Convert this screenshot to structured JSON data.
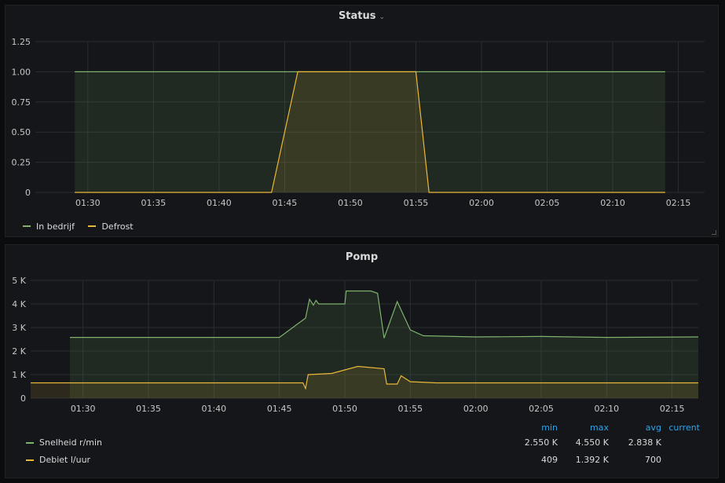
{
  "panels": [
    {
      "title": "Status",
      "chart_data": {
        "type": "area",
        "x_ticks": [
          "01:30",
          "01:35",
          "01:40",
          "01:45",
          "01:50",
          "01:55",
          "02:00",
          "02:05",
          "02:10",
          "02:15"
        ],
        "y_ticks": [
          "1.25",
          "1.00",
          "0.75",
          "0.50",
          "0.25",
          "0"
        ],
        "ylim": [
          0,
          1.25
        ],
        "xlim_minutes": [
          "01:26",
          "02:17"
        ],
        "grid": true,
        "legend_position": "bottom-left",
        "series": [
          {
            "name": "In bedrijf",
            "color": "#7eb26d",
            "points": [
              [
                "01:29",
                1
              ],
              [
                "02:14",
                1
              ]
            ]
          },
          {
            "name": "Defrost",
            "color": "#eab839",
            "points": [
              [
                "01:29",
                0
              ],
              [
                "01:44",
                0
              ],
              [
                "01:46",
                1
              ],
              [
                "01:55",
                1
              ],
              [
                "01:56",
                0
              ],
              [
                "02:14",
                0
              ]
            ]
          }
        ]
      }
    },
    {
      "title": "Pomp",
      "chart_data": {
        "type": "area",
        "x_ticks": [
          "01:30",
          "01:35",
          "01:40",
          "01:45",
          "01:50",
          "01:55",
          "02:00",
          "02:05",
          "02:10",
          "02:15"
        ],
        "y_ticks": [
          "5 K",
          "4 K",
          "3 K",
          "2 K",
          "1 K",
          "0"
        ],
        "ylim": [
          0,
          5000
        ],
        "xlim_minutes": [
          "01:26",
          "02:17"
        ],
        "grid": true,
        "legend_position": "bottom",
        "series": [
          {
            "name": "Snelheid r/min",
            "color": "#7eb26d",
            "points": [
              [
                "01:29",
                2580
              ],
              [
                "01:45",
                2580
              ],
              [
                "01:47",
                3400
              ],
              [
                "01:47.3",
                4200
              ],
              [
                "01:47.6",
                3950
              ],
              [
                "01:47.8",
                4150
              ],
              [
                "01:48",
                4000
              ],
              [
                "01:50",
                4000
              ],
              [
                "01:50.1",
                4550
              ],
              [
                "01:52",
                4550
              ],
              [
                "01:52.5",
                4450
              ],
              [
                "01:53",
                2550
              ],
              [
                "01:54",
                4100
              ],
              [
                "01:55",
                2900
              ],
              [
                "01:56",
                2650
              ],
              [
                "02:00",
                2600
              ],
              [
                "02:05",
                2620
              ],
              [
                "02:10",
                2580
              ],
              [
                "02:17",
                2600
              ]
            ]
          },
          {
            "name": "Debiet l/uur",
            "color": "#eab839",
            "points": [
              [
                "01:26",
                650
              ],
              [
                "01:46.8",
                650
              ],
              [
                "01:47",
                409
              ],
              [
                "01:47.2",
                1000
              ],
              [
                "01:49",
                1050
              ],
              [
                "01:50",
                1200
              ],
              [
                "01:51",
                1350
              ],
              [
                "01:53",
                1250
              ],
              [
                "01:53.2",
                600
              ],
              [
                "01:54",
                600
              ],
              [
                "01:54.3",
                950
              ],
              [
                "01:55",
                700
              ],
              [
                "01:57",
                650
              ],
              [
                "02:17",
                650
              ]
            ]
          }
        ],
        "legend_stats": {
          "headers": [
            "min",
            "max",
            "avg",
            "current"
          ],
          "rows": [
            {
              "name": "Snelheid r/min",
              "min": "2.550 K",
              "max": "4.550 K",
              "avg": "2.838 K",
              "current": ""
            },
            {
              "name": "Debiet l/uur",
              "min": "409",
              "max": "1.392 K",
              "avg": "700",
              "current": ""
            }
          ]
        }
      }
    }
  ]
}
